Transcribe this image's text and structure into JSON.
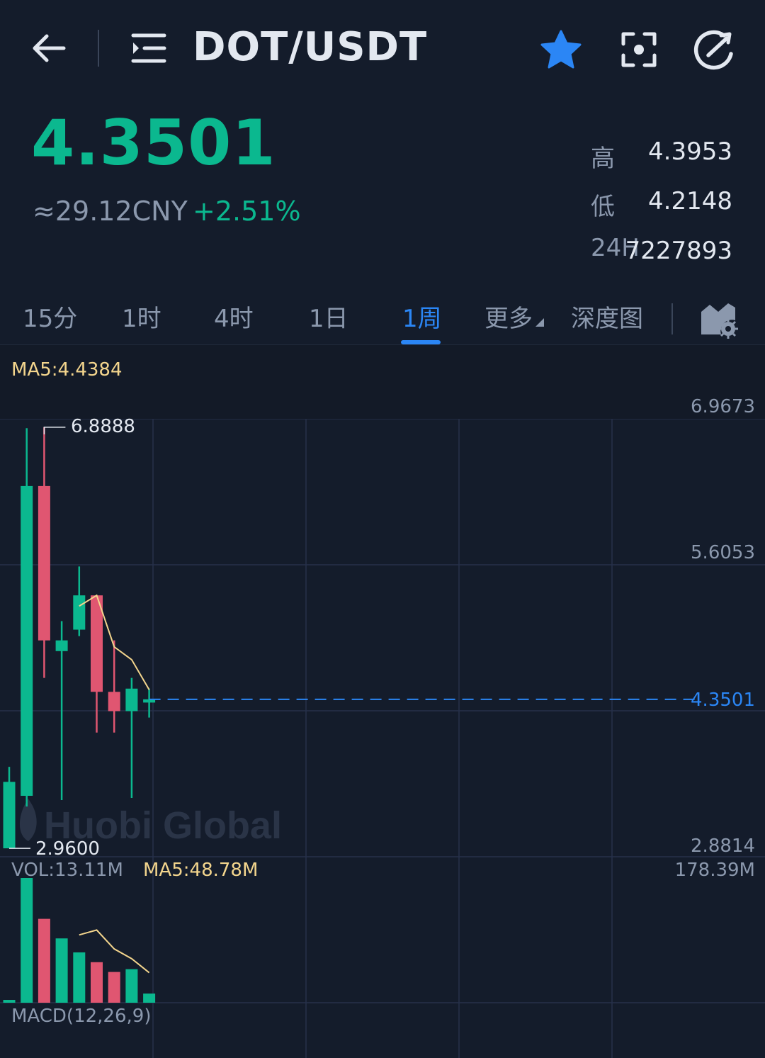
{
  "header": {
    "pair": "DOT/USDT",
    "icons": [
      "back-arrow-icon",
      "menu-list-icon",
      "star-icon",
      "scan-icon",
      "refresh-icon"
    ],
    "star_color": "#2b86f5"
  },
  "ticker": {
    "last_price": "4.3501",
    "cny_equiv": "≈29.12CNY",
    "change_pct": "+2.51%",
    "high_label": "高",
    "high_value": "4.3953",
    "low_label": "低",
    "low_value": "4.2148",
    "vol_label": "24H",
    "vol_value": "7227893",
    "up_color": "#0bb88f"
  },
  "tabs": {
    "items": [
      "15分",
      "1时",
      "4时",
      "1日",
      "1周",
      "更多",
      "深度图"
    ],
    "active": "1周",
    "settings_icon": "chart-settings-icon"
  },
  "chart": {
    "ma5_label": "MA5:4.4384",
    "axis_labels": [
      "6.9673",
      "5.6053",
      "4.3501",
      "2.8814"
    ],
    "high_marker": "6.8888",
    "low_marker": "2.9600",
    "watermark": "Huobi Global",
    "vol_label": "VOL:13.11M",
    "vol_ma_label": "MA5:48.78M",
    "vol_max_label": "178.39M",
    "macd_label": "MACD(12,26,9)",
    "up_color": "#0bb88f",
    "down_color": "#e05671",
    "ma_color": "#f3d58d",
    "current_line_color": "#2b86f5"
  },
  "chart_data": {
    "type": "candlestick",
    "price_range": [
      2.8814,
      6.9673
    ],
    "candles": [
      {
        "open": 2.96,
        "close": 3.58,
        "high": 3.72,
        "low": 2.96
      },
      {
        "open": 3.45,
        "close": 6.34,
        "high": 6.88,
        "low": 3.35
      },
      {
        "open": 6.34,
        "close": 4.9,
        "high": 6.8888,
        "low": 4.55
      },
      {
        "open": 4.8,
        "close": 4.9,
        "high": 5.08,
        "low": 3.41
      },
      {
        "open": 5.0,
        "close": 5.32,
        "high": 5.59,
        "low": 4.94
      },
      {
        "open": 5.32,
        "close": 4.42,
        "high": 5.32,
        "low": 4.04
      },
      {
        "open": 4.42,
        "close": 4.24,
        "high": 4.9,
        "low": 4.04
      },
      {
        "open": 4.24,
        "close": 4.45,
        "high": 4.55,
        "low": 3.43
      },
      {
        "open": 4.32,
        "close": 4.35,
        "high": 4.45,
        "low": 4.18
      }
    ],
    "ma5": [
      null,
      null,
      null,
      null,
      5.22,
      5.32,
      4.84,
      4.72,
      4.44
    ],
    "volume_max": 178.39,
    "volume_unit": "M",
    "volumes": [
      {
        "value": 4,
        "up": true
      },
      {
        "value": 178.39,
        "up": true
      },
      {
        "value": 120,
        "up": false
      },
      {
        "value": 92,
        "up": true
      },
      {
        "value": 72,
        "up": true
      },
      {
        "value": 58,
        "up": false
      },
      {
        "value": 44,
        "up": false
      },
      {
        "value": 48,
        "up": true
      },
      {
        "value": 13.11,
        "up": true
      }
    ],
    "volume_ma5": [
      null,
      null,
      null,
      null,
      97,
      104,
      77,
      63,
      43
    ]
  }
}
